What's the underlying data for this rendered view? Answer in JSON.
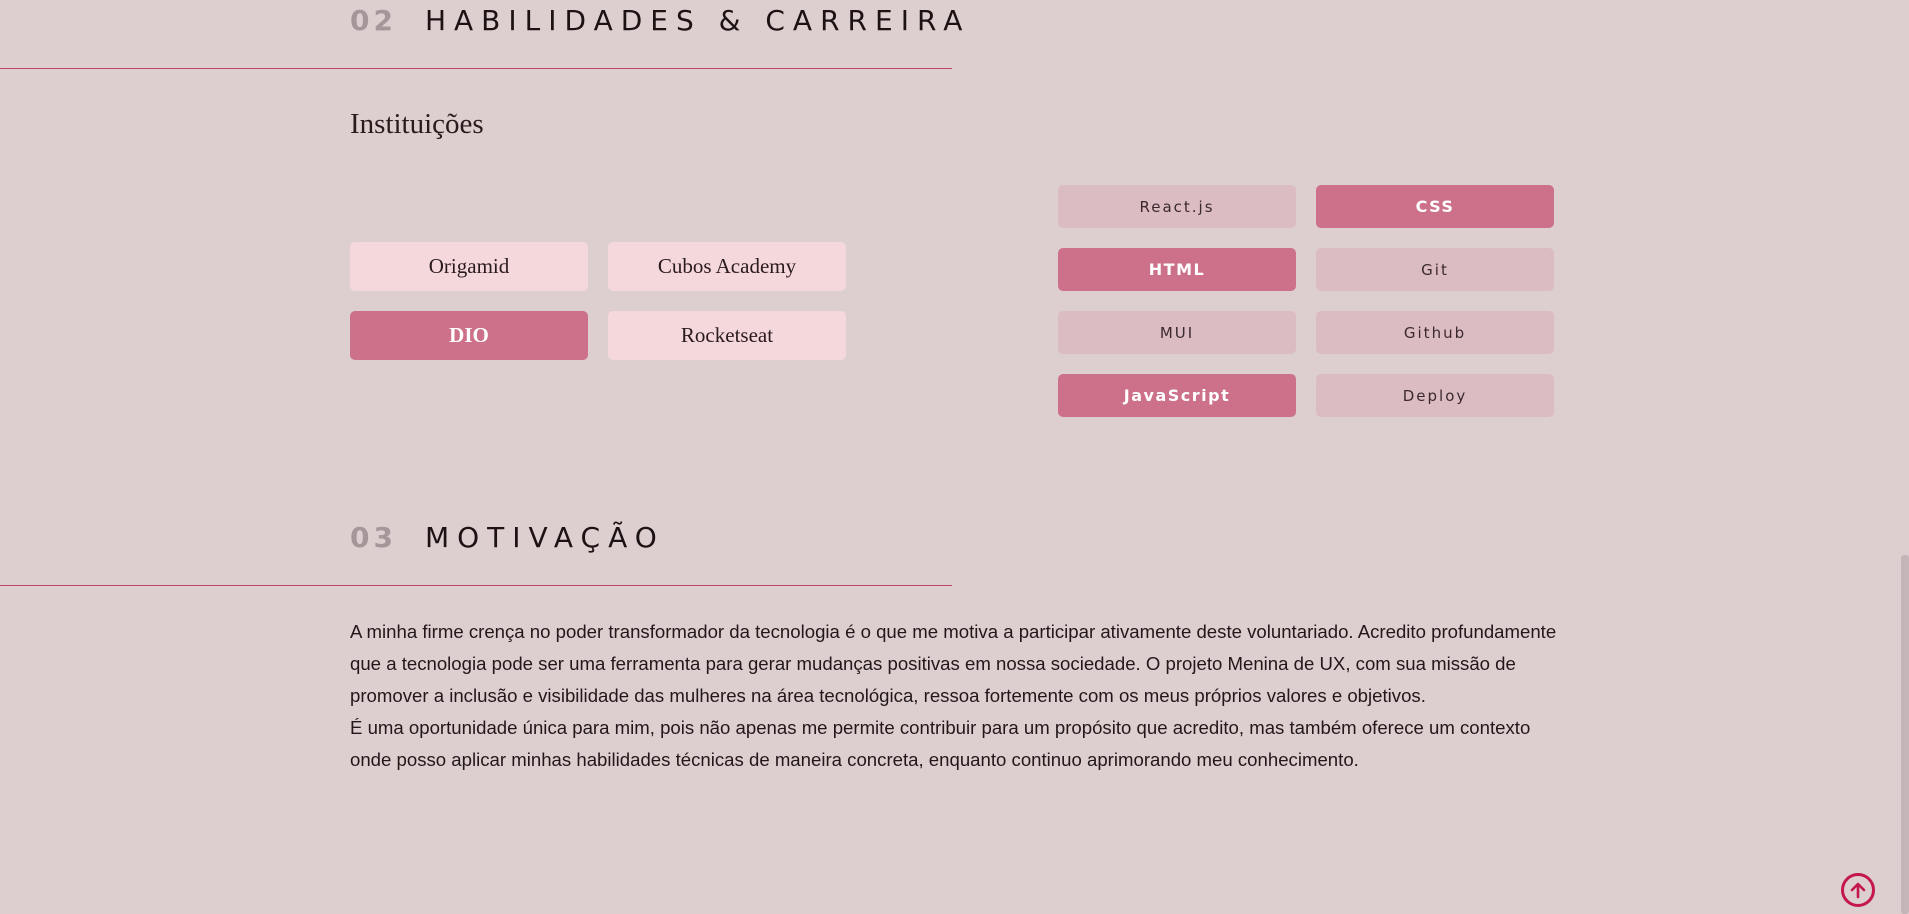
{
  "skills_section": {
    "number": "02",
    "title": "HABILIDADES & CARREIRA"
  },
  "institutions": {
    "heading": "Instituições",
    "items": [
      {
        "label": "Origamid",
        "active": false
      },
      {
        "label": "Cubos Academy",
        "active": false
      },
      {
        "label": "DIO",
        "active": true
      },
      {
        "label": "Rocketseat",
        "active": false
      }
    ]
  },
  "skills": {
    "items": [
      {
        "label": "React.js",
        "active": false
      },
      {
        "label": "CSS",
        "active": true
      },
      {
        "label": "HTML",
        "active": true
      },
      {
        "label": "Git",
        "active": false
      },
      {
        "label": "MUI",
        "active": false
      },
      {
        "label": "Github",
        "active": false
      },
      {
        "label": "JavaScript",
        "active": true
      },
      {
        "label": "Deploy",
        "active": false
      }
    ]
  },
  "motivation_section": {
    "number": "03",
    "title": "MOTIVAÇÃO",
    "paragraphs": [
      "A minha firme crença no poder transformador da tecnologia é o que me motiva a participar ativamente deste voluntariado. Acredito profundamente que a tecnologia pode ser uma ferramenta para gerar mudanças positivas em nossa sociedade. O projeto Menina de UX, com sua missão de promover a inclusão e visibilidade das mulheres na área tecnológica, ressoa fortemente com os meus próprios valores e objetivos.",
      "É uma oportunidade única para mim, pois não apenas me permite contribuir para um propósito que acredito, mas também oferece um contexto onde posso aplicar minhas habilidades técnicas de maneira concreta, enquanto continuo aprimorando meu conhecimento."
    ]
  },
  "scroll_top": {
    "icon": "arrow-up-circle-icon"
  },
  "colors": {
    "background": "#ddcfcf",
    "accent": "#cc7189",
    "rule": "#c44467",
    "institution_inactive": "#f4d8dc",
    "skill_inactive": "#dcbcc3",
    "scroll_top": "#c4174d"
  }
}
